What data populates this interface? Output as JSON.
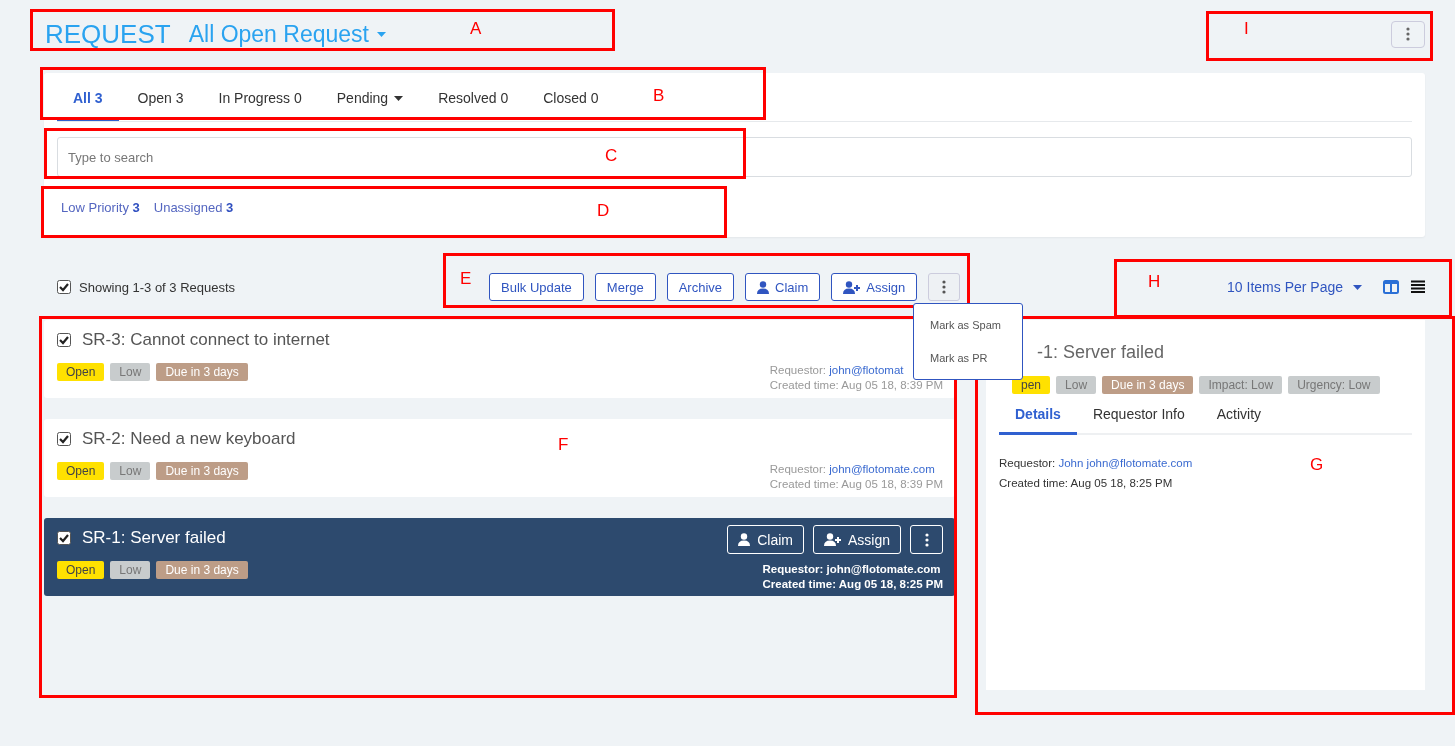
{
  "header": {
    "title": "REQUEST",
    "view": "All Open Request"
  },
  "tabs": [
    {
      "label": "All 3",
      "selected": true,
      "dropdown": false
    },
    {
      "label": "Open 3",
      "selected": false,
      "dropdown": false
    },
    {
      "label": "In Progress 0",
      "selected": false,
      "dropdown": false
    },
    {
      "label": "Pending",
      "selected": false,
      "dropdown": true
    },
    {
      "label": "Resolved 0",
      "selected": false,
      "dropdown": false
    },
    {
      "label": "Closed 0",
      "selected": false,
      "dropdown": false
    }
  ],
  "search": {
    "placeholder": "Type to search"
  },
  "quick_filters": [
    {
      "label": "Low Priority",
      "count": "3"
    },
    {
      "label": "Unassigned",
      "count": "3"
    }
  ],
  "list_header": {
    "checked": true,
    "text": "Showing 1-3 of 3 Requests"
  },
  "bulk_actions": [
    {
      "label": "Bulk Update",
      "kind": "text"
    },
    {
      "label": "Merge",
      "kind": "text"
    },
    {
      "label": "Archive",
      "kind": "text"
    },
    {
      "label": "Claim",
      "kind": "user"
    },
    {
      "label": "Assign",
      "kind": "user-plus"
    },
    {
      "kind": "more"
    }
  ],
  "more_menu": [
    "Mark as Spam",
    "Mark as PR"
  ],
  "per_page": "10 Items Per Page",
  "view_modes": [
    {
      "kind": "split",
      "selected": true
    },
    {
      "kind": "list",
      "selected": false
    }
  ],
  "requests": [
    {
      "title": "SR-3: Cannot connect to internet",
      "checked": true,
      "selected": false,
      "tags": [
        {
          "label": "Open",
          "color": "#ffe100"
        },
        {
          "label": "Low",
          "color": "#c8cccd"
        },
        {
          "label": "Due in 3 days",
          "color": "#bd9d87"
        }
      ],
      "requestor_label": "Requestor:",
      "requestor": "john@flotomat",
      "created": "Created time: Aug 05 18, 8:39 PM"
    },
    {
      "title": "SR-2: Need a new keyboard",
      "checked": true,
      "selected": false,
      "tags": [
        {
          "label": "Open",
          "color": "#ffe100"
        },
        {
          "label": "Low",
          "color": "#c8cccd"
        },
        {
          "label": "Due in 3 days",
          "color": "#bd9d87"
        }
      ],
      "requestor_label": "Requestor:",
      "requestor": "john@flotomate.com",
      "created": "Created time: Aug 05 18, 8:39 PM"
    },
    {
      "title": "SR-1: Server failed",
      "checked": true,
      "selected": true,
      "tags": [
        {
          "label": "Open",
          "color": "#ffe100"
        },
        {
          "label": "Low",
          "color": "#c8cccd"
        },
        {
          "label": "Due in 3 days",
          "color": "#bd9d87"
        }
      ],
      "requestor_label": "Requestor:",
      "requestor": "john@flotomate.com",
      "created": "Created time: Aug 05 18, 8:25 PM",
      "actions": [
        {
          "label": "Claim",
          "kind": "user"
        },
        {
          "label": "Assign",
          "kind": "user-plus"
        },
        {
          "kind": "more"
        }
      ]
    }
  ],
  "detail": {
    "title": "-1: Server failed",
    "tags": [
      {
        "label": "pen",
        "color": "#ffe100"
      },
      {
        "label": "Low",
        "color": "#c8cccd"
      },
      {
        "label": "Due in 3 days",
        "color": "#bd9d87"
      },
      {
        "label": "Impact: Low",
        "color": "#c8cccd"
      },
      {
        "label": "Urgency: Low",
        "color": "#c8cccd"
      }
    ],
    "tabs": [
      {
        "label": "Details",
        "selected": true
      },
      {
        "label": "Requestor Info",
        "selected": false
      },
      {
        "label": "Activity",
        "selected": false
      }
    ],
    "requestor_label": "Requestor:",
    "requestor": "John john@flotomate.com",
    "created": "Created time: Aug 05 18, 8:25 PM"
  },
  "annotations": [
    {
      "label": "A"
    },
    {
      "label": "B"
    },
    {
      "label": "C"
    },
    {
      "label": "D"
    },
    {
      "label": "E"
    },
    {
      "label": "F"
    },
    {
      "label": "G"
    },
    {
      "label": "H"
    },
    {
      "label": "I"
    }
  ]
}
